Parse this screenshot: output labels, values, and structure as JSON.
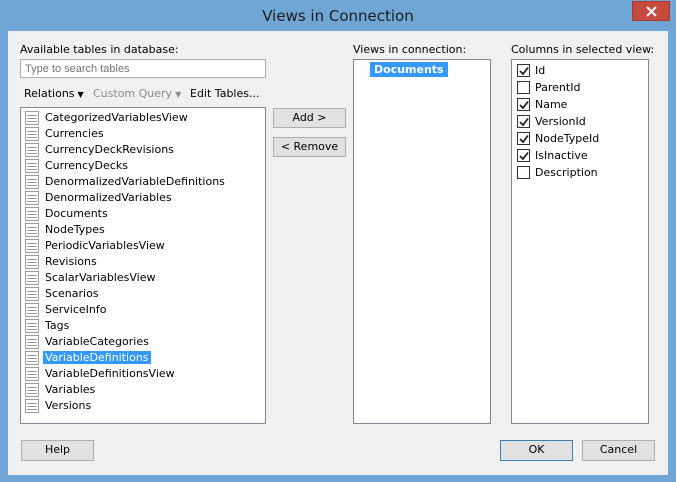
{
  "window": {
    "title": "Views in Connection"
  },
  "labels": {
    "available_tables": "Available tables in database:",
    "views_in_connection": "Views in connection:",
    "columns_in_view": "Columns in selected view:"
  },
  "search": {
    "placeholder": "Type to search tables"
  },
  "toolbar": {
    "relations": "Relations",
    "custom_query": "Custom Query",
    "edit_tables": "Edit Tables..."
  },
  "tables": [
    "CategorizedVariablesView",
    "Currencies",
    "CurrencyDeckRevisions",
    "CurrencyDecks",
    "DenormalizedVariableDefinitions",
    "DenormalizedVariables",
    "Documents",
    "NodeTypes",
    "PeriodicVariablesView",
    "Revisions",
    "ScalarVariablesView",
    "Scenarios",
    "ServiceInfo",
    "Tags",
    "VariableCategories",
    "VariableDefinitions",
    "VariableDefinitionsView",
    "Variables",
    "Versions"
  ],
  "selected_table": "VariableDefinitions",
  "buttons": {
    "add": "Add >",
    "remove": "< Remove",
    "help": "Help",
    "ok": "OK",
    "cancel": "Cancel"
  },
  "views": [
    "Documents"
  ],
  "columns": [
    {
      "name": "Id",
      "checked": true
    },
    {
      "name": "ParentId",
      "checked": false
    },
    {
      "name": "Name",
      "checked": true
    },
    {
      "name": "VersionId",
      "checked": true
    },
    {
      "name": "NodeTypeId",
      "checked": true
    },
    {
      "name": "IsInactive",
      "checked": true
    },
    {
      "name": "Description",
      "checked": false
    }
  ]
}
